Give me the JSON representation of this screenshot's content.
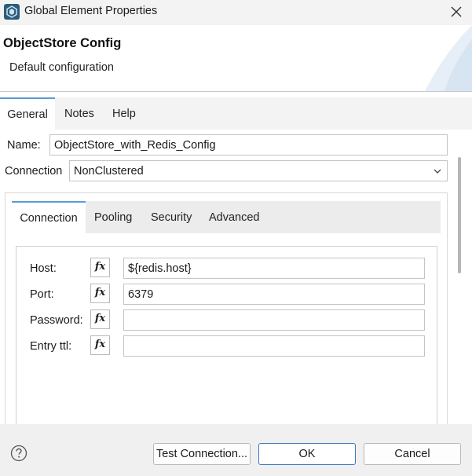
{
  "window": {
    "title": "Global Element Properties"
  },
  "header": {
    "title": "ObjectStore Config",
    "subtitle": "Default configuration"
  },
  "outer_tabs": [
    {
      "label": "General",
      "active": true
    },
    {
      "label": "Notes",
      "active": false
    },
    {
      "label": "Help",
      "active": false
    }
  ],
  "general": {
    "name_label": "Name:",
    "name_value": "ObjectStore_with_Redis_Config",
    "connection_label": "Connection",
    "connection_value": "NonClustered"
  },
  "inner_tabs": [
    {
      "label": "Connection",
      "active": true
    },
    {
      "label": "Pooling",
      "active": false
    },
    {
      "label": "Security",
      "active": false
    },
    {
      "label": "Advanced",
      "active": false
    }
  ],
  "connection_fields": [
    {
      "label": "Host:",
      "value": "${redis.host}"
    },
    {
      "label": "Port:",
      "value": "6379"
    },
    {
      "label": "Password:",
      "value": ""
    },
    {
      "label": "Entry ttl:",
      "value": ""
    }
  ],
  "fx_label": "fx",
  "footer": {
    "test_button": "Test Connection...",
    "ok_button": "OK",
    "cancel_button": "Cancel"
  },
  "colors": {
    "accent": "#5a9ad6",
    "ok_border": "#3b78c4"
  }
}
